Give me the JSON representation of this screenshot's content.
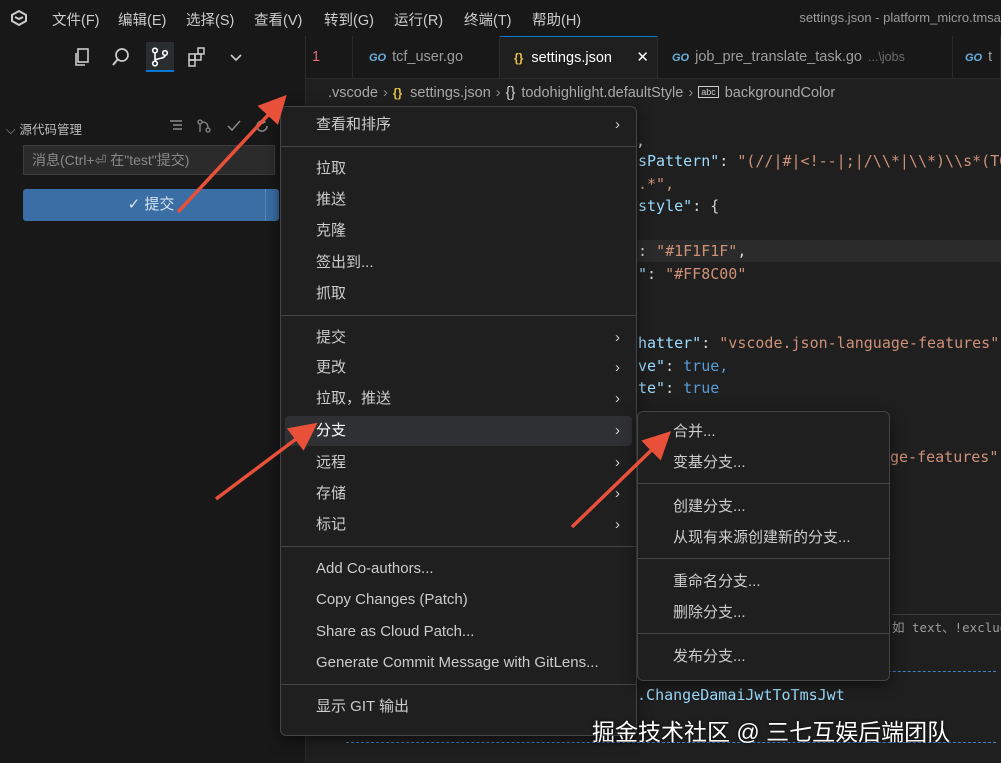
{
  "titlebar": {
    "menu": [
      "文件(F)",
      "编辑(E)",
      "选择(S)",
      "查看(V)",
      "转到(G)",
      "运行(R)",
      "终端(T)",
      "帮助(H)"
    ],
    "window_title": "settings.json - platform_micro.tmsapi"
  },
  "sidebar": {
    "header": "源代码管理",
    "commit_placeholder": "消息(Ctrl+⏎ 在\"test\"提交)",
    "commit_button": "✓ 提交",
    "more_button": "···"
  },
  "tabs": [
    {
      "icon": "GO",
      "label": "",
      "prefix": "1"
    },
    {
      "icon": "GO",
      "label": "tcf_user.go"
    },
    {
      "icon": "{}",
      "label": "settings.json",
      "close": "✕"
    },
    {
      "icon": "GO",
      "label": "job_pre_translate_task.go",
      "path": "...\\jobs"
    },
    {
      "icon": "GO",
      "label": "t"
    }
  ],
  "breadcrumb": [
    {
      "label": ".vscode"
    },
    {
      "icon": "{}",
      "label": "settings.json"
    },
    {
      "icon": "{}",
      "label": "todohighlight.defaultStyle"
    },
    {
      "icon": "abc",
      "label": "backgroundColor"
    }
  ],
  "code": {
    "l1": ",",
    "l2_key": "sPattern\"",
    "l2_val": "\"(//|#|<!--|;|/\\\\*|\\\\*)\\\\s*(TO",
    "l3": ".*\",",
    "l4_key": "style\"",
    "l4_punct": ": {",
    "l5_val": "\"#1F1F1F\"",
    "l6_key": "\"",
    "l6_val": "\"#FF8C00\"",
    "l7": "",
    "l8_key": "hatter\"",
    "l8_val": "\"vscode.json-language-features\"",
    "l9_key": "ve\"",
    "l9_val": "true,",
    "l10_key": "te\"",
    "l10_val": "true",
    "l11_val": "ge-features\"",
    "filter": "如 text、!exclude_",
    "gitlens": "f.ChangeDamaiJwtToTmsJwt"
  },
  "context_menu": {
    "items": [
      {
        "label": "查看和排序",
        "submenu": true
      },
      {
        "label": "拉取"
      },
      {
        "label": "推送"
      },
      {
        "label": "克隆"
      },
      {
        "label": "签出到..."
      },
      {
        "label": "抓取"
      },
      {
        "label": "提交",
        "submenu": true
      },
      {
        "label": "更改",
        "submenu": true
      },
      {
        "label": "拉取，推送",
        "submenu": true
      },
      {
        "label": "分支",
        "submenu": true,
        "hovered": true
      },
      {
        "label": "远程",
        "submenu": true
      },
      {
        "label": "存储",
        "submenu": true
      },
      {
        "label": "标记",
        "submenu": true
      },
      {
        "label": "Add Co-authors..."
      },
      {
        "label": "Copy Changes (Patch)"
      },
      {
        "label": "Share as Cloud Patch..."
      },
      {
        "label": "Generate Commit Message with GitLens..."
      },
      {
        "label": "显示 GIT 输出"
      }
    ]
  },
  "branch_submenu": {
    "items": [
      {
        "label": "合并..."
      },
      {
        "label": "变基分支..."
      },
      {
        "label": "创建分支..."
      },
      {
        "label": "从现有来源创建新的分支..."
      },
      {
        "label": "重命名分支..."
      },
      {
        "label": "删除分支..."
      },
      {
        "label": "发布分支..."
      }
    ]
  },
  "watermark": "掘金技术社区 @ 三七互娱后端团队",
  "colors": {
    "accent": "#0078d4",
    "arrow": "#e8503a",
    "commit_button": "#3a6ea5"
  }
}
